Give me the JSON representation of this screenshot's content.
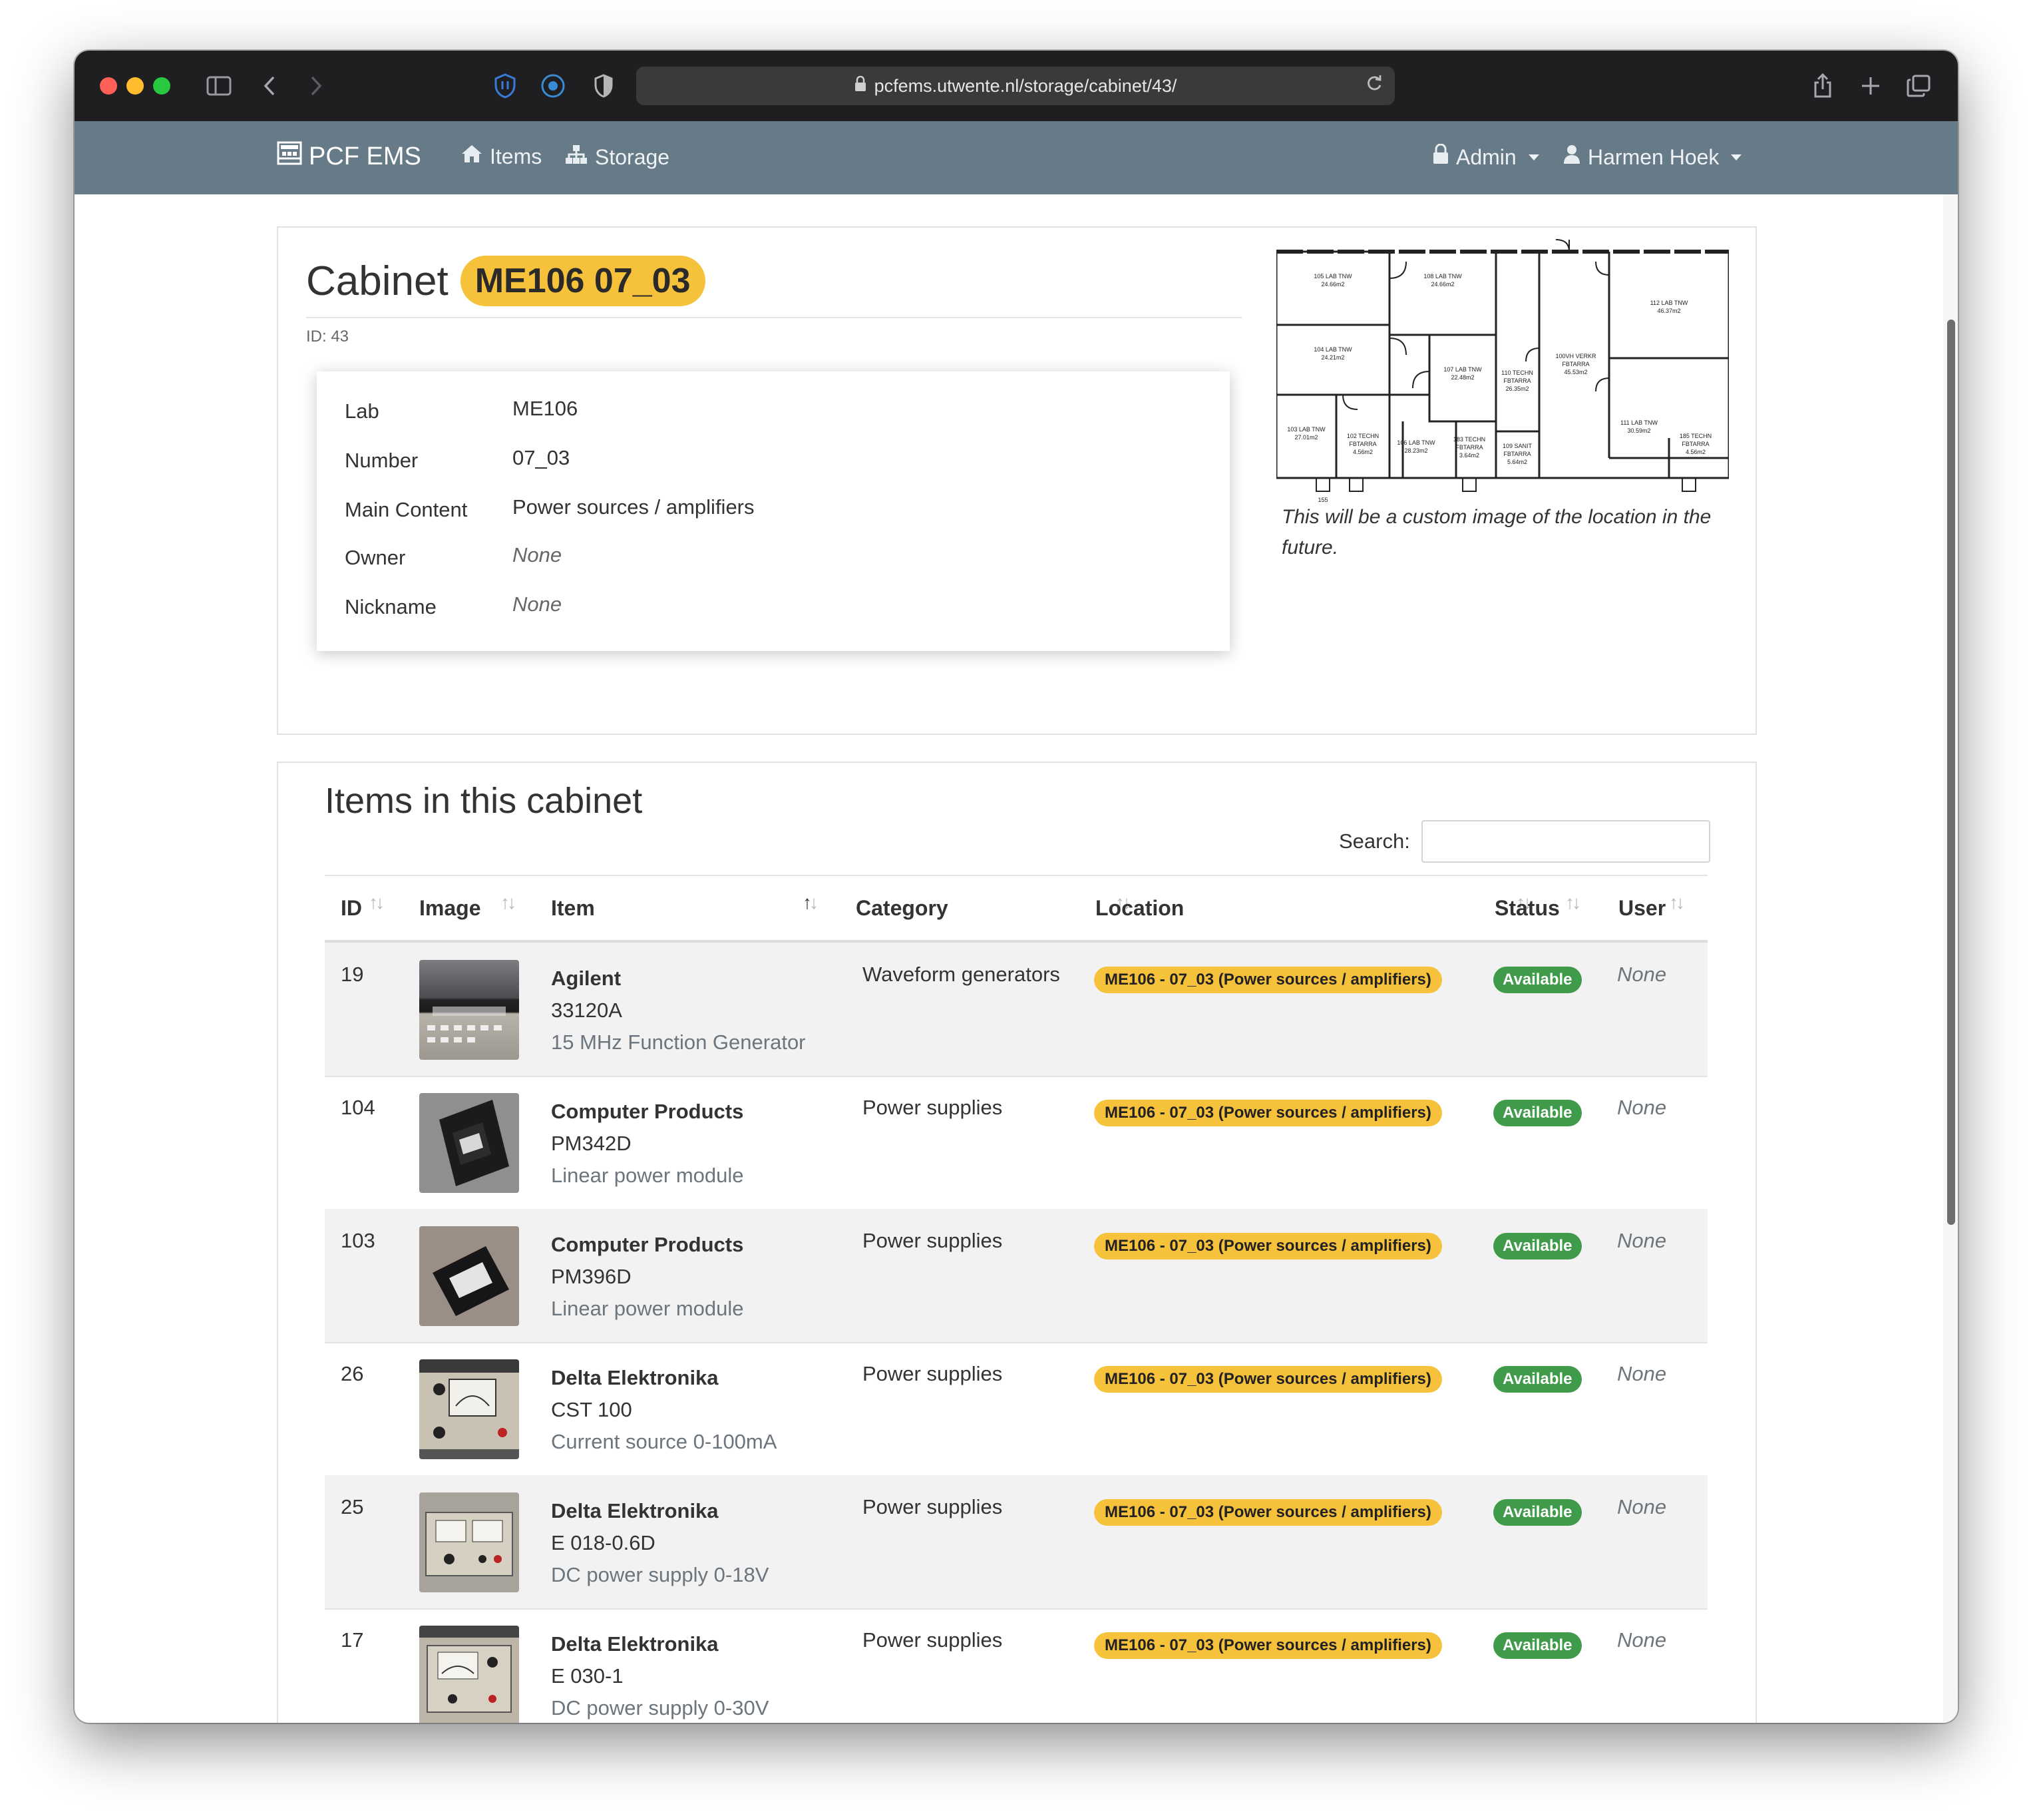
{
  "browser": {
    "url": "pcfems.utwente.nl/storage/cabinet/43/"
  },
  "navbar": {
    "brand": "PCF EMS",
    "items_label": "Items",
    "storage_label": "Storage",
    "admin_label": "Admin",
    "user_label": "Harmen Hoek",
    "background_color": "#667a88"
  },
  "cabinet": {
    "title_prefix": "Cabinet",
    "badge": "ME106 07_03",
    "id_text": "ID: 43",
    "fields": [
      {
        "label": "Lab",
        "value": "ME106"
      },
      {
        "label": "Number",
        "value": "07_03"
      },
      {
        "label": "Main Content",
        "value": "Power sources / amplifiers"
      },
      {
        "label": "Owner",
        "value": "None"
      },
      {
        "label": "Nickname",
        "value": "None"
      }
    ],
    "image_caption": "This will be a custom image of the location in the future."
  },
  "items_section": {
    "title": "Items in this cabinet",
    "search_label": "Search:",
    "search_value": "",
    "columns": [
      "ID",
      "Image",
      "Item",
      "Category",
      "Location",
      "Status",
      "User"
    ],
    "rows": [
      {
        "id": "19",
        "brand": "Agilent",
        "model": "33120A",
        "description": "15 MHz Function Generator",
        "category": "Waveform generators",
        "location": "ME106 - 07_03 (Power sources / amplifiers)",
        "status": "Available",
        "user": "None"
      },
      {
        "id": "104",
        "brand": "Computer Products",
        "model": "PM342D",
        "description": "Linear power module",
        "category": "Power supplies",
        "location": "ME106 - 07_03 (Power sources / amplifiers)",
        "status": "Available",
        "user": "None"
      },
      {
        "id": "103",
        "brand": "Computer Products",
        "model": "PM396D",
        "description": "Linear power module",
        "category": "Power supplies",
        "location": "ME106 - 07_03 (Power sources / amplifiers)",
        "status": "Available",
        "user": "None"
      },
      {
        "id": "26",
        "brand": "Delta Elektronika",
        "model": "CST 100",
        "description": "Current source 0-100mA",
        "category": "Power supplies",
        "location": "ME106 - 07_03 (Power sources / amplifiers)",
        "status": "Available",
        "user": "None"
      },
      {
        "id": "25",
        "brand": "Delta Elektronika",
        "model": "E 018-0.6D",
        "description": "DC power supply 0-18V",
        "category": "Power supplies",
        "location": "ME106 - 07_03 (Power sources / amplifiers)",
        "status": "Available",
        "user": "None"
      },
      {
        "id": "17",
        "brand": "Delta Elektronika",
        "model": "E 030-1",
        "description": "DC power supply 0-30V",
        "category": "Power supplies",
        "location": "ME106 - 07_03 (Power sources / amplifiers)",
        "status": "Available",
        "user": "None"
      }
    ]
  },
  "floorplan_labels": [
    "105 LAB TNW 24.66m2",
    "108 LAB TNW 24.66m2",
    "104 LAB TNW 24.21m2",
    "107 LAB TNW 22.48m2",
    "110 TECHN FBTARRA 26.35m2",
    "100VH VERKR FBTARRA 45.53m2",
    "112 LAB TNW 46.37m2",
    "103 LAB TNW 27.01m2",
    "102 TECHN FBTARRA 4.56m2",
    "106 LAB TNW 28.23m2",
    "183 TECHN FBTARRA 3.64m2",
    "109 SANIT FBTARRA 5.64m2",
    "111 LAB TNW 30.59m2",
    "185 TECHN FBTARRA 4.56m2",
    "155"
  ],
  "colors": {
    "badge_yellow": "#f7c23b",
    "status_green": "#3f9b49"
  }
}
